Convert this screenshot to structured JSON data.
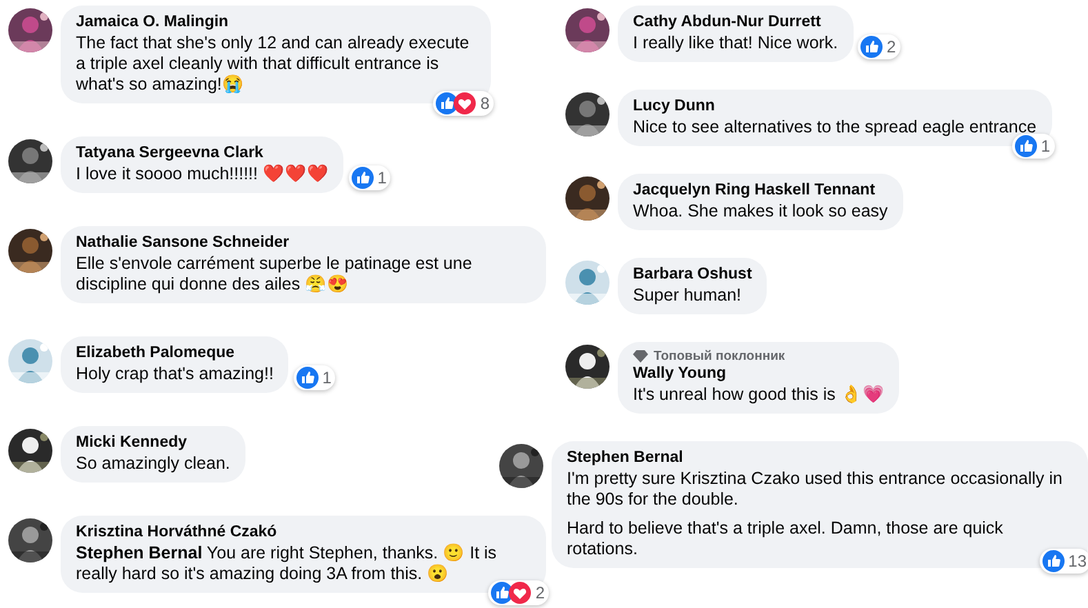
{
  "columns": [
    {
      "comments": [
        {
          "name": "Jamaica O. Malingin",
          "paragraphs": [
            "The fact that she's only 12 and can already execute a triple axel cleanly with that difficult entrance is what's so amazing!😭"
          ],
          "reactions": {
            "like": true,
            "love": true,
            "count": "8",
            "beside": false
          }
        },
        {
          "name": "Tatyana Sergeevna Clark",
          "paragraphs": [
            "I love it soooo much!!!!!! ❤️❤️❤️"
          ],
          "reactions": {
            "like": true,
            "love": false,
            "count": "1",
            "beside": true
          }
        },
        {
          "name": "Nathalie Sansone Schneider",
          "paragraphs": [
            "Elle s'envole carrément superbe le patinage est une discipline qui donne des ailes 😤😍"
          ]
        },
        {
          "name": "Elizabeth Palomeque",
          "paragraphs": [
            "Holy crap that's amazing!!"
          ],
          "reactions": {
            "like": true,
            "love": false,
            "count": "1",
            "beside": true
          }
        },
        {
          "name": "Micki Kennedy",
          "paragraphs": [
            "So amazingly clean."
          ]
        },
        {
          "name": "Krisztina Horváthné Czakó",
          "paragraphs": [
            "**Stephen Bernal** You are right Stephen, thanks. 🙂 It is really hard so it's amazing doing 3A from this. 😮"
          ],
          "reactions": {
            "like": true,
            "love": true,
            "count": "2",
            "beside": false
          }
        }
      ]
    },
    {
      "comments": [
        {
          "name": "Cathy Abdun-Nur Durrett",
          "paragraphs": [
            "I really like that! Nice work."
          ],
          "reactions": {
            "like": true,
            "love": false,
            "count": "2",
            "beside": true
          }
        },
        {
          "name": "Lucy Dunn",
          "paragraphs": [
            "Nice to see alternatives to the spread eagle entrance"
          ],
          "reactions": {
            "like": true,
            "love": false,
            "count": "1",
            "beside": false
          }
        },
        {
          "name": "Jacquelyn Ring Haskell Tennant",
          "paragraphs": [
            "Whoa. She makes it look so easy"
          ]
        },
        {
          "name": "Barbara Oshust",
          "paragraphs": [
            "Super human!"
          ]
        },
        {
          "badge": "Топовый поклонник",
          "name": "Wally Young",
          "paragraphs": [
            "It's unreal how good this is 👌💗"
          ]
        },
        {
          "name": "Stephen Bernal",
          "paragraphs": [
            "I'm pretty sure Krisztina Czako used this entrance occasionally in the 90s for the double.",
            "Hard to believe that's a triple axel. Damn, those are quick rotations."
          ],
          "reactions": {
            "like": true,
            "love": false,
            "count": "13",
            "beside": false
          }
        }
      ]
    }
  ]
}
